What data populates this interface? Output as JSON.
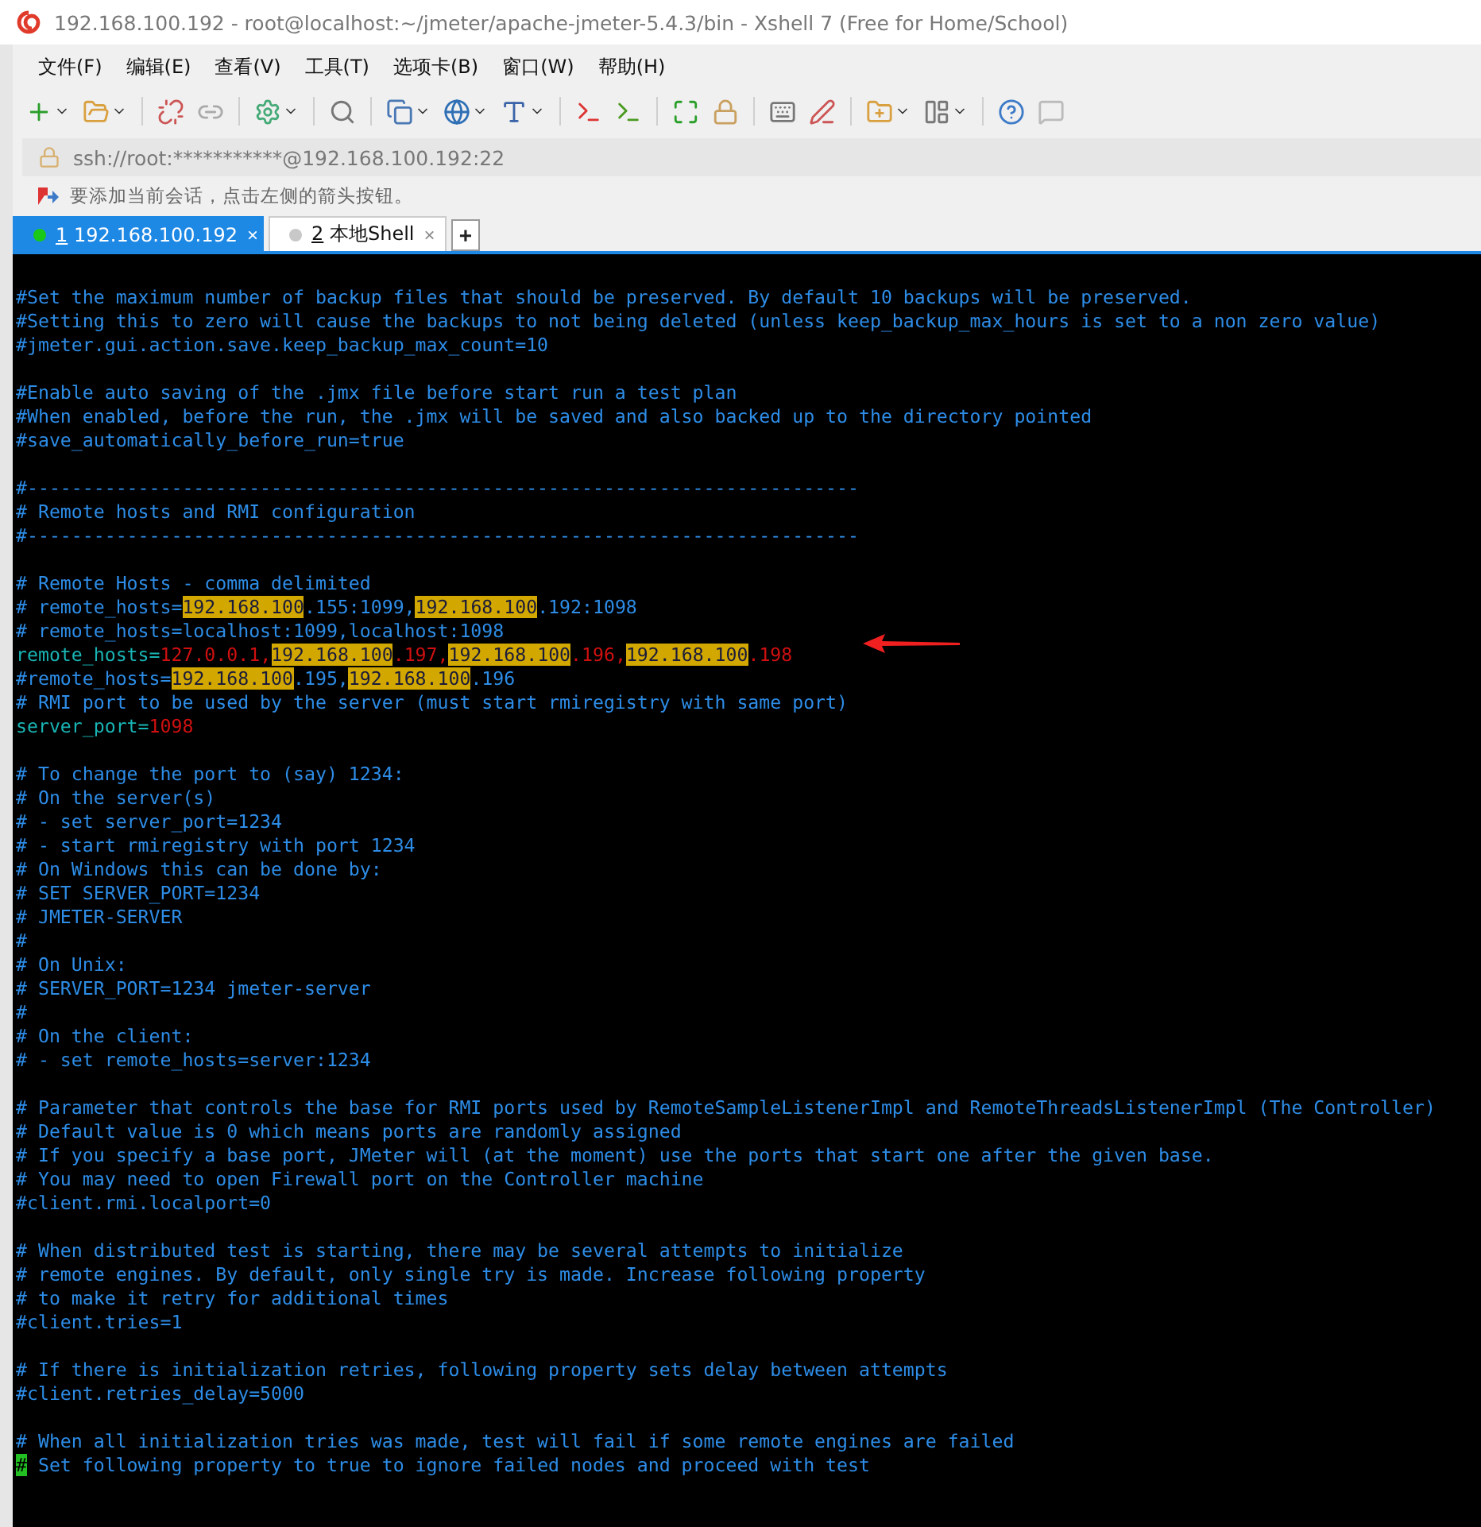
{
  "window": {
    "title": "192.168.100.192 - root@localhost:~/jmeter/apache-jmeter-5.4.3/bin - Xshell 7 (Free for Home/School)"
  },
  "menu": [
    "文件(F)",
    "编辑(E)",
    "查看(V)",
    "工具(T)",
    "选项卡(B)",
    "窗口(W)",
    "帮助(H)"
  ],
  "address_bar": {
    "value": "ssh://root:***********@192.168.100.192:22"
  },
  "hint_bar": {
    "text": "要添加当前会话，点击左侧的箭头按钮。"
  },
  "tabs": [
    {
      "number": "1",
      "label": "192.168.100.192",
      "selected": true,
      "color": "#19c819",
      "close": "×"
    },
    {
      "number": "2",
      "label": "本地Shell",
      "selected": false,
      "color": "#c8c8c8",
      "close": "×"
    }
  ],
  "new_tab": "+",
  "terminal": {
    "lines": [
      {
        "kind": "text",
        "segments": [
          {
            "text": "#Set the maximum number of backup files that should be preserved. By default 10 backups will be preserved.",
            "kind": "comment"
          }
        ]
      },
      {
        "kind": "text",
        "segments": [
          {
            "text": "#Setting this to zero will cause the backups to not being deleted (unless keep_backup_max_hours is set to a non zero value)",
            "kind": "comment"
          }
        ]
      },
      {
        "kind": "text",
        "segments": [
          {
            "text": "#jmeter.gui.action.save.keep_backup_max_count=10",
            "kind": "comment"
          }
        ]
      },
      {
        "kind": "blank"
      },
      {
        "kind": "text",
        "segments": [
          {
            "text": "#Enable auto saving of the .jmx file before start run a test plan",
            "kind": "comment"
          }
        ]
      },
      {
        "kind": "text",
        "segments": [
          {
            "text": "#When enabled, before the run, the .jmx will be saved and also backed up to the directory pointed",
            "kind": "comment"
          }
        ]
      },
      {
        "kind": "text",
        "segments": [
          {
            "text": "#save_automatically_before_run=true",
            "kind": "comment"
          }
        ]
      },
      {
        "kind": "blank"
      },
      {
        "kind": "text",
        "segments": [
          {
            "text": "#---------------------------------------------------------------------------",
            "kind": "comment"
          }
        ]
      },
      {
        "kind": "text",
        "segments": [
          {
            "text": "# Remote hosts and RMI configuration",
            "kind": "comment"
          }
        ]
      },
      {
        "kind": "text",
        "segments": [
          {
            "text": "#---------------------------------------------------------------------------",
            "kind": "comment"
          }
        ]
      },
      {
        "kind": "blank"
      },
      {
        "kind": "text",
        "segments": [
          {
            "text": "# Remote Hosts - comma delimited",
            "kind": "comment"
          }
        ]
      },
      {
        "kind": "text",
        "segments": [
          {
            "text": "# remote_hosts=",
            "kind": "comment"
          },
          {
            "text": "192.168.100",
            "kind": "match"
          },
          {
            "text": ".155:1099,",
            "kind": "comment"
          },
          {
            "text": "192.168.100",
            "kind": "match"
          },
          {
            "text": ".192:1098",
            "kind": "comment"
          }
        ]
      },
      {
        "kind": "text",
        "segments": [
          {
            "text": "# remote_hosts=localhost:1099,localhost:1098",
            "kind": "comment"
          }
        ]
      },
      {
        "kind": "text",
        "segments": [
          {
            "text": "remote_hosts=",
            "kind": "key"
          },
          {
            "text": "127.0.0.1,",
            "kind": "value"
          },
          {
            "text": "192.168.100",
            "kind": "match"
          },
          {
            "text": ".197,",
            "kind": "value"
          },
          {
            "text": "192.168.100",
            "kind": "match"
          },
          {
            "text": ".196,",
            "kind": "value"
          },
          {
            "text": "192.168.100",
            "kind": "match"
          },
          {
            "text": ".198",
            "kind": "value"
          }
        ]
      },
      {
        "kind": "text",
        "segments": [
          {
            "text": "#remote_hosts=",
            "kind": "comment"
          },
          {
            "text": "192.168.100",
            "kind": "match"
          },
          {
            "text": ".195,",
            "kind": "comment"
          },
          {
            "text": "192.168.100",
            "kind": "match"
          },
          {
            "text": ".196",
            "kind": "comment"
          }
        ]
      },
      {
        "kind": "text",
        "segments": [
          {
            "text": "# RMI port to be used by the server (must start rmiregistry with same port)",
            "kind": "comment"
          }
        ]
      },
      {
        "kind": "text",
        "segments": [
          {
            "text": "server_port=",
            "kind": "key"
          },
          {
            "text": "1098",
            "kind": "value"
          }
        ]
      },
      {
        "kind": "blank"
      },
      {
        "kind": "text",
        "segments": [
          {
            "text": "# To change the port to (say) 1234:",
            "kind": "comment"
          }
        ]
      },
      {
        "kind": "text",
        "segments": [
          {
            "text": "# On the server(s)",
            "kind": "comment"
          }
        ]
      },
      {
        "kind": "text",
        "segments": [
          {
            "text": "# - set server_port=1234",
            "kind": "comment"
          }
        ]
      },
      {
        "kind": "text",
        "segments": [
          {
            "text": "# - start rmiregistry with port 1234",
            "kind": "comment"
          }
        ]
      },
      {
        "kind": "text",
        "segments": [
          {
            "text": "# On Windows this can be done by:",
            "kind": "comment"
          }
        ]
      },
      {
        "kind": "text",
        "segments": [
          {
            "text": "# SET SERVER_PORT=1234",
            "kind": "comment"
          }
        ]
      },
      {
        "kind": "text",
        "segments": [
          {
            "text": "# JMETER-SERVER",
            "kind": "comment"
          }
        ]
      },
      {
        "kind": "text",
        "segments": [
          {
            "text": "#",
            "kind": "comment"
          }
        ]
      },
      {
        "kind": "text",
        "segments": [
          {
            "text": "# On Unix:",
            "kind": "comment"
          }
        ]
      },
      {
        "kind": "text",
        "segments": [
          {
            "text": "# SERVER_PORT=1234 jmeter-server",
            "kind": "comment"
          }
        ]
      },
      {
        "kind": "text",
        "segments": [
          {
            "text": "#",
            "kind": "comment"
          }
        ]
      },
      {
        "kind": "text",
        "segments": [
          {
            "text": "# On the client:",
            "kind": "comment"
          }
        ]
      },
      {
        "kind": "text",
        "segments": [
          {
            "text": "# - set remote_hosts=server:1234",
            "kind": "comment"
          }
        ]
      },
      {
        "kind": "blank"
      },
      {
        "kind": "text",
        "segments": [
          {
            "text": "# Parameter that controls the base for RMI ports used by RemoteSampleListenerImpl and RemoteThreadsListenerImpl (The Controller)",
            "kind": "comment"
          }
        ]
      },
      {
        "kind": "text",
        "segments": [
          {
            "text": "# Default value is 0 which means ports are randomly assigned",
            "kind": "comment"
          }
        ]
      },
      {
        "kind": "text",
        "segments": [
          {
            "text": "# If you specify a base port, JMeter will (at the moment) use the ports that start one after the given base.",
            "kind": "comment"
          }
        ]
      },
      {
        "kind": "text",
        "segments": [
          {
            "text": "# You may need to open Firewall port on the Controller machine",
            "kind": "comment"
          }
        ]
      },
      {
        "kind": "text",
        "segments": [
          {
            "text": "#client.rmi.localport=0",
            "kind": "comment"
          }
        ]
      },
      {
        "kind": "blank"
      },
      {
        "kind": "text",
        "segments": [
          {
            "text": "# When distributed test is starting, there may be several attempts to initialize",
            "kind": "comment"
          }
        ]
      },
      {
        "kind": "text",
        "segments": [
          {
            "text": "# remote engines. By default, only single try is made. Increase following property",
            "kind": "comment"
          }
        ]
      },
      {
        "kind": "text",
        "segments": [
          {
            "text": "# to make it retry for additional times",
            "kind": "comment"
          }
        ]
      },
      {
        "kind": "text",
        "segments": [
          {
            "text": "#client.tries=1",
            "kind": "comment"
          }
        ]
      },
      {
        "kind": "blank"
      },
      {
        "kind": "text",
        "segments": [
          {
            "text": "# If there is initialization retries, following property sets delay between attempts",
            "kind": "comment"
          }
        ]
      },
      {
        "kind": "text",
        "segments": [
          {
            "text": "#client.retries_delay=5000",
            "kind": "comment"
          }
        ]
      },
      {
        "kind": "blank"
      },
      {
        "kind": "text",
        "segments": [
          {
            "text": "# When all initialization tries was made, test will fail if some remote engines are failed",
            "kind": "comment"
          }
        ]
      },
      {
        "kind": "text",
        "segments": [
          {
            "text": "#",
            "kind": "cursor"
          },
          {
            "text": " Set following property to true to ignore failed nodes and proceed with test",
            "kind": "comment"
          }
        ]
      }
    ]
  }
}
